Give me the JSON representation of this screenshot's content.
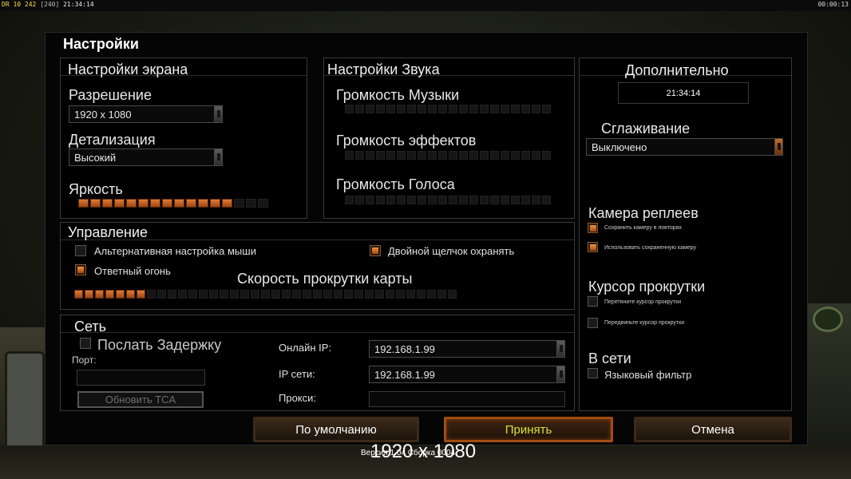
{
  "hud": {
    "left_a": "DR 10 242",
    "left_b": "[240]",
    "left_time": "21:34:14",
    "right_time": "00:00:13"
  },
  "dialog": {
    "title": "Настройки"
  },
  "screen": {
    "title": "Настройки экрана",
    "resolution_label": "Разрешение",
    "resolution_value": "1920 x 1080",
    "detail_label": "Детализация",
    "detail_value": "Высокий",
    "brightness_label": "Яркость",
    "brightness": {
      "filled": 13,
      "total": 16
    }
  },
  "sound": {
    "title": "Настройки Звука",
    "music_label": "Громкость Музыки",
    "effects_label": "Громкость эффектов",
    "voice_label": "Громкость Голоса"
  },
  "extra": {
    "title": "Дополнительно",
    "clock": "21:34:14",
    "aa_label": "Сглаживание",
    "aa_value": "Выключено",
    "replay_title": "Камера реплеев",
    "replay_opt1": "Сохранить камеру в повторах",
    "replay_opt1_checked": true,
    "replay_opt2": "Использовать сохраненную камеру",
    "replay_opt2_checked": true,
    "cursor_title": "Курсор прокрутки",
    "cursor_opt1": "Перетяните курсор прокрутки",
    "cursor_opt1_checked": false,
    "cursor_opt2": "Передвиньте курсор прокрутки",
    "cursor_opt2_checked": false,
    "online_title": "В сети",
    "lang_filter": "Языковый фильтр",
    "lang_filter_checked": false
  },
  "control": {
    "title": "Управление",
    "alt_mouse": "Альтернативная настройка мыши",
    "alt_mouse_checked": false,
    "double_click": "Двойной щелчок охранять",
    "double_click_checked": true,
    "return_fire": "Ответный огонь",
    "return_fire_checked": true,
    "scroll_label": "Скорость прокрутки карты",
    "scroll_speed": {
      "filled": 7,
      "total": 37
    }
  },
  "network": {
    "title": "Сеть",
    "send_delay": "Послать Задержку",
    "send_delay_checked": false,
    "port_label": "Порт:",
    "port_value": "",
    "update_tca": "Обновить TCA",
    "online_ip_label": "Онлайн IP:",
    "online_ip_value": "192.168.1.99",
    "lan_ip_label": "IP сети:",
    "lan_ip_value": "192.168.1.99",
    "proxy_label": "Прокси:",
    "proxy_value": ""
  },
  "buttons": {
    "default": "По умолчанию",
    "accept": "Принять",
    "cancel": "Отмена"
  },
  "footer": {
    "version": "Версия 1.04 Сборка 0004",
    "resolution": "1920 x 1080"
  },
  "colors": {
    "accent_orange": "#e27a32",
    "accept_text": "#d6e03a",
    "background": "#050505"
  }
}
